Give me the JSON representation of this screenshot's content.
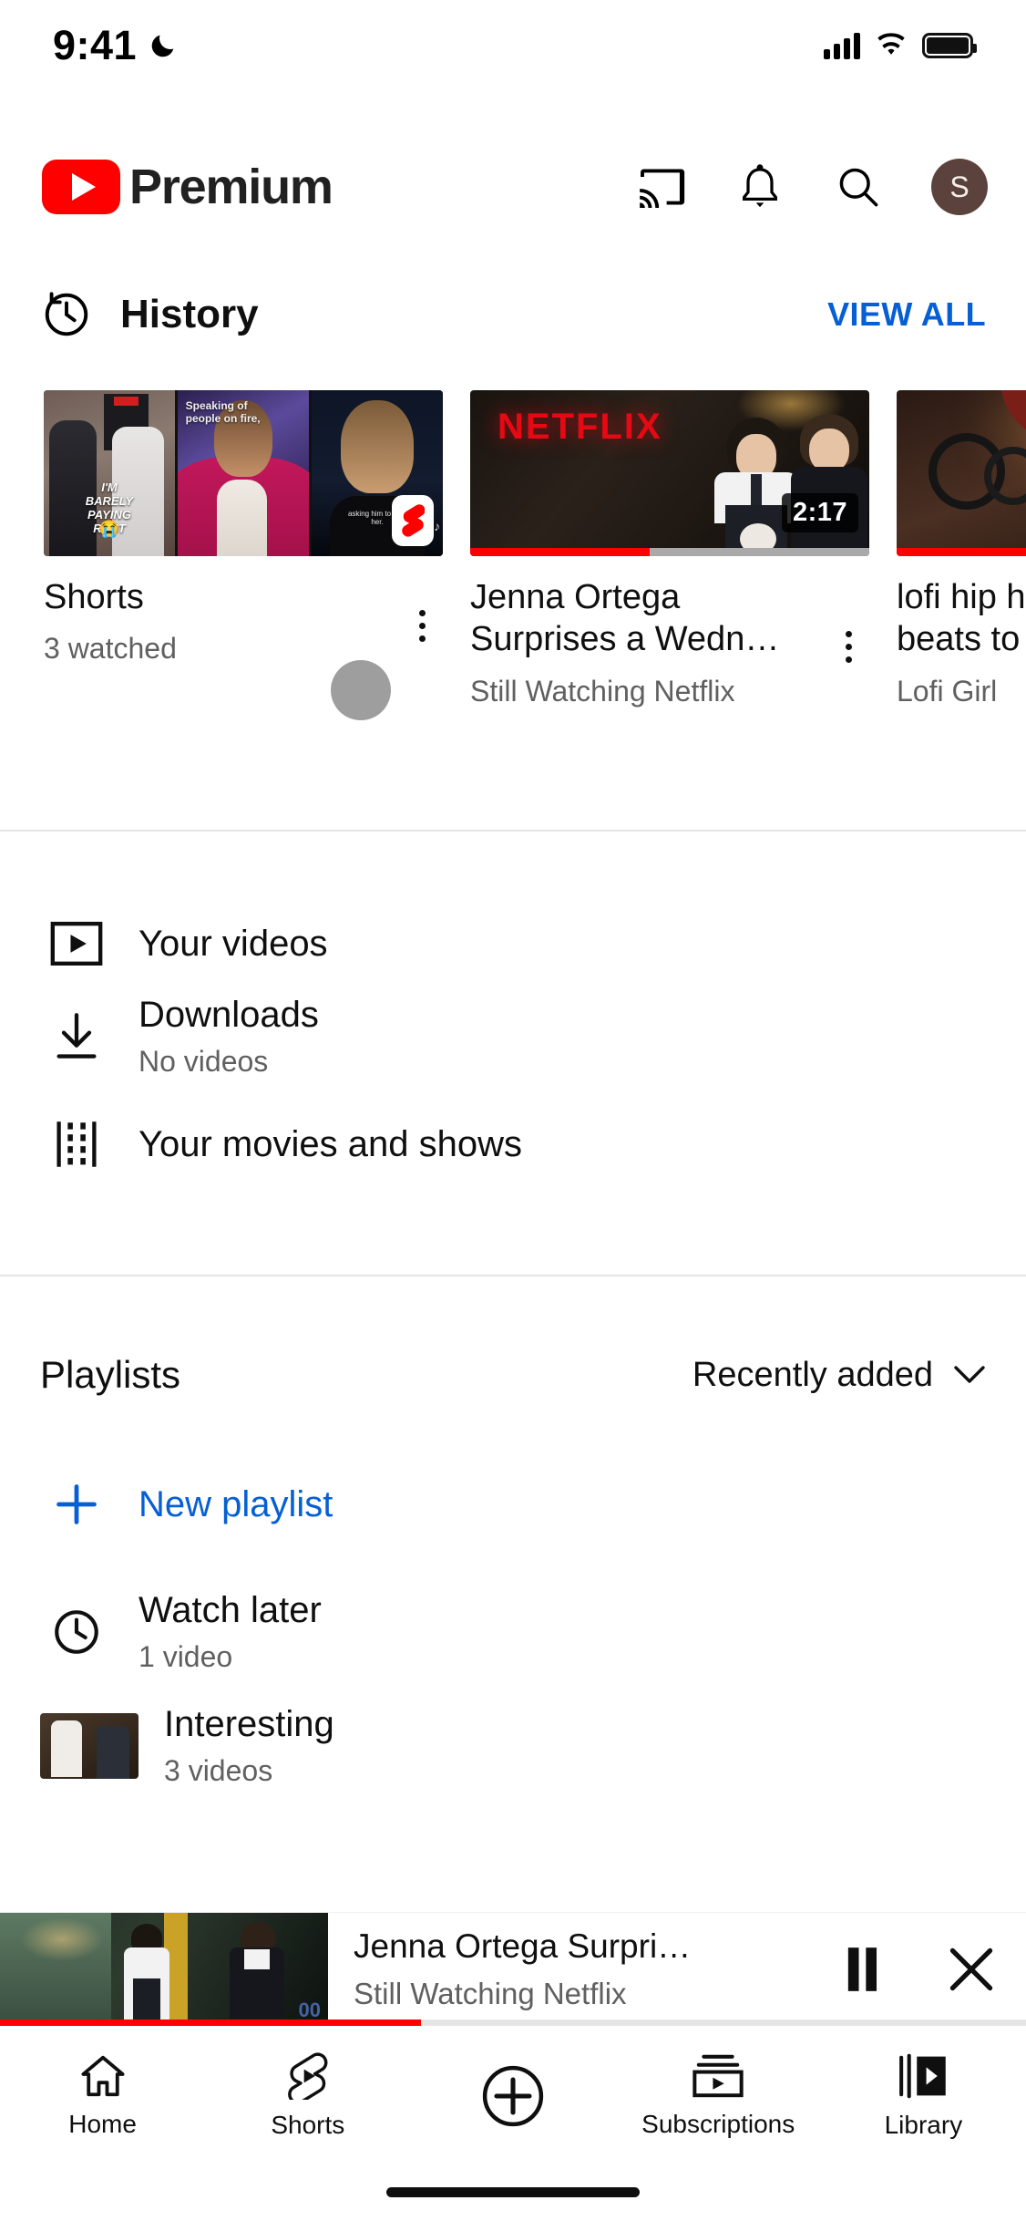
{
  "status_bar": {
    "time": "9:41",
    "dnd_icon": "moon-icon",
    "signal_icon": "cellular-signal-icon",
    "wifi_icon": "wifi-icon",
    "battery_icon": "battery-icon"
  },
  "app_bar": {
    "brand": "Premium",
    "logo_icon": "youtube-logo-icon",
    "cast_icon": "cast-icon",
    "notifications_icon": "bell-icon",
    "search_icon": "search-icon",
    "avatar_initial": "S",
    "avatar_color": "#5b423c"
  },
  "history": {
    "icon": "history-clock-icon",
    "title": "History",
    "view_all": "VIEW ALL",
    "cards": [
      {
        "type": "shorts",
        "title": "Shorts",
        "subtitle": "3 watched",
        "menu_icon": "kebab-menu-icon",
        "badge_icon": "shorts-badge-icon",
        "panel_captions": [
          "I'M BARELY\nPAYING RENT",
          "Speaking of\npeople on fire,",
          "asking him to love her."
        ],
        "panel_emoji": "😭"
      },
      {
        "type": "video",
        "title": "Jenna Ortega Surprises a Wedn…",
        "subtitle": "Still Watching Netflix",
        "duration": "2:17",
        "progress_percent": 45,
        "overlay_text": "NETFLIX",
        "menu_icon": "kebab-menu-icon"
      },
      {
        "type": "video",
        "title": "lofi hip hop radio – beats to relax/study to",
        "subtitle": "Lofi Girl",
        "progress_percent": 100,
        "menu_icon": "kebab-menu-icon"
      }
    ]
  },
  "library": {
    "items": [
      {
        "icon": "your-videos-icon",
        "title": "Your videos",
        "subtitle": ""
      },
      {
        "icon": "downloads-icon",
        "title": "Downloads",
        "subtitle": "No videos"
      },
      {
        "icon": "film-strip-icon",
        "title": "Your movies and shows",
        "subtitle": ""
      }
    ]
  },
  "playlists": {
    "heading": "Playlists",
    "sort_label": "Recently added",
    "sort_icon": "chevron-down-icon",
    "new_playlist": {
      "icon": "plus-icon",
      "label": "New playlist"
    },
    "rows": [
      {
        "icon": "clock-icon",
        "title": "Watch later",
        "subtitle": "1 video"
      },
      {
        "icon": "playlist-thumbnail",
        "title": "Interesting",
        "subtitle": "3 videos"
      }
    ]
  },
  "mini_player": {
    "title": "Jenna Ortega Surpri…",
    "subtitle": "Still Watching Netflix",
    "pause_icon": "pause-icon",
    "close_icon": "close-icon",
    "progress_percent": 41
  },
  "bottom_nav": {
    "items": [
      {
        "icon": "home-icon",
        "label": "Home"
      },
      {
        "icon": "shorts-icon",
        "label": "Shorts"
      },
      {
        "icon": "create-plus-icon",
        "label": ""
      },
      {
        "icon": "subscriptions-icon",
        "label": "Subscriptions"
      },
      {
        "icon": "library-icon",
        "label": "Library"
      }
    ]
  },
  "colors": {
    "youtube_red": "#ff0000",
    "link_blue": "#065fd4",
    "netflix_red": "#e50914",
    "secondary_text": "#606060"
  }
}
